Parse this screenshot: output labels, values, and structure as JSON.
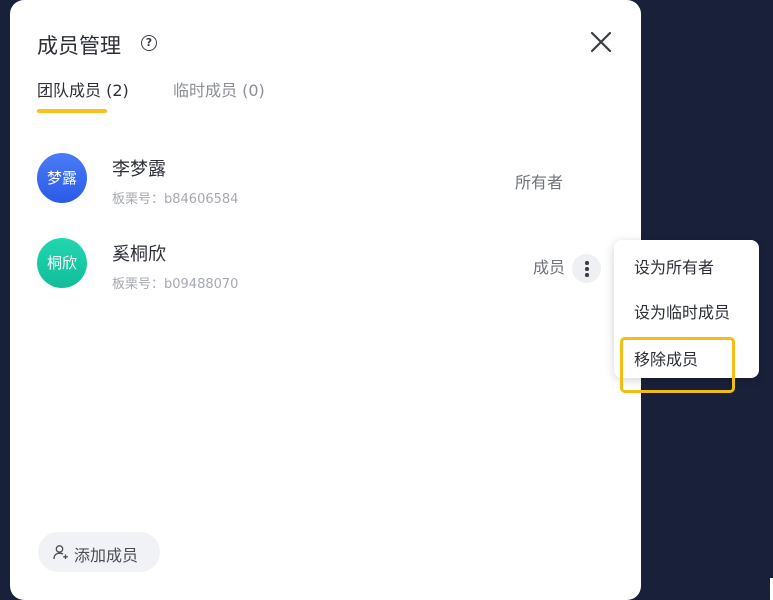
{
  "dialog": {
    "title": "成员管理",
    "help_icon": "?",
    "tabs": [
      {
        "label": "团队成员 (2)",
        "active": true
      },
      {
        "label": "临时成员 (0)",
        "active": false
      }
    ],
    "members": [
      {
        "avatar_text": "梦露",
        "avatar_color": "#3565f0",
        "name": "李梦露",
        "id": "板栗号：b84606584",
        "role": "所有者"
      },
      {
        "avatar_text": "桐欣",
        "avatar_color": "#17c9a3",
        "name": "奚桐欣",
        "id": "板栗号：b09488070",
        "role": "成员"
      }
    ],
    "add_button": "添加成员"
  },
  "context_menu": {
    "items": [
      "设为所有者",
      "设为临时成员",
      "移除成员"
    ],
    "highlighted_item": "移除成员",
    "highlight_color": "#f5bd12"
  },
  "colors": {
    "backdrop": "#19203a",
    "tab_accent": "#f7c21a"
  }
}
